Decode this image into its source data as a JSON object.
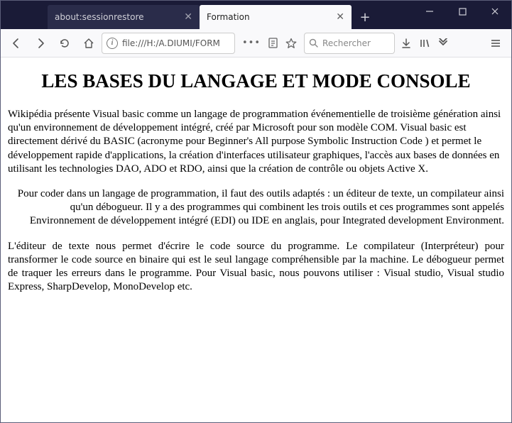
{
  "window": {
    "tabs": [
      {
        "label": "about:sessionrestore",
        "active": false
      },
      {
        "label": "Formation",
        "active": true
      }
    ]
  },
  "toolbar": {
    "url_info_glyph": "i",
    "url_display": "file:///H:/A.DIUMI/FORM",
    "actions_more": "•••",
    "search_placeholder": "Rechercher"
  },
  "page": {
    "title": "LES BASES DU LANGAGE ET MODE CONSOLE",
    "p1": "Wikipédia présente Visual basic comme un langage de programmation événementielle de troisième génération ainsi qu'un environnement de développement intégré, créé par Microsoft pour son modèle COM. Visual basic est directement dérivé du BASIC (acronyme pour Beginner's All purpose Symbolic Instruction Code ) et permet le développement rapide d'applications, la création d'interfaces utilisateur graphiques, l'accès aux bases de données en utilisant les technologies DAO, ADO et RDO, ainsi que la création de contrôle ou objets Active X.",
    "p2": "Pour coder dans un langage de programmation, il faut des outils adaptés : un éditeur de texte, un compilateur ainsi qu'un débogueur. Il y a des programmes qui combinent les trois outils et ces programmes sont appelés Environnement de développement intégré (EDI) ou IDE en anglais, pour Integrated development Environment.",
    "p3": "L'éditeur de texte nous permet d'écrire le code source du programme. Le compilateur (Interpréteur) pour transformer le code source en binaire qui est le seul langage compréhensible par la machine. Le débogueur permet de traquer les erreurs dans le programme. Pour Visual basic, nous pouvons utiliser : Visual studio, Visual studio Express, SharpDevelop, MonoDevelop etc."
  }
}
